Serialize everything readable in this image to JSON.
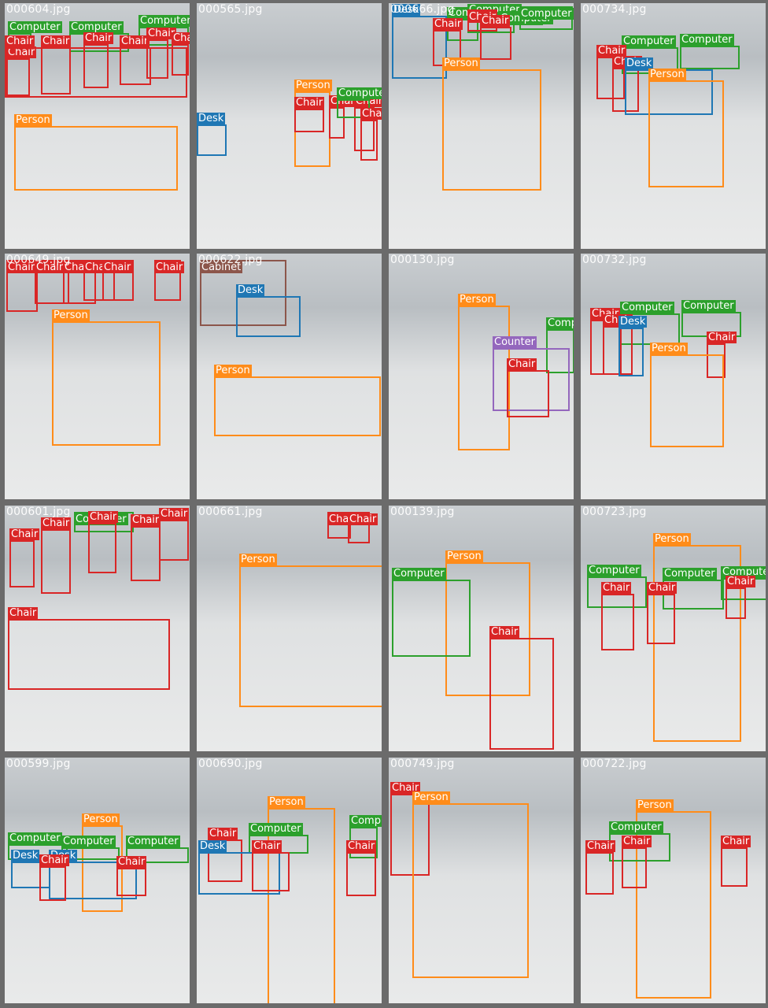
{
  "class_colors": {
    "Person": "#ff8c1a",
    "Chair": "#d92626",
    "Computer": "#2ca02c",
    "Desk": "#1f77b4",
    "Counter": "#9467bd",
    "Cabinet": "#8c564b"
  },
  "tiles": [
    {
      "filename": "000604.jpg",
      "boxes": [
        {
          "label": "Computer"
        },
        {
          "label": "Computer"
        },
        {
          "label": "Computer"
        },
        {
          "label": "Chair"
        },
        {
          "label": "Chair"
        },
        {
          "label": "Chair"
        },
        {
          "label": "Chair"
        },
        {
          "label": "Chair"
        },
        {
          "label": "Chair"
        },
        {
          "label": "Chair"
        },
        {
          "label": "Person"
        }
      ]
    },
    {
      "filename": "000565.jpg",
      "boxes": [
        {
          "label": "Desk"
        },
        {
          "label": "Person"
        },
        {
          "label": "Chair"
        },
        {
          "label": "Chair"
        },
        {
          "label": "Chair"
        },
        {
          "label": "Computer"
        },
        {
          "label": "Chair"
        }
      ]
    },
    {
      "filename": "000666.jpg",
      "boxes": [
        {
          "label": "Desk"
        },
        {
          "label": "Computer"
        },
        {
          "label": "Computer"
        },
        {
          "label": "Computer"
        },
        {
          "label": "Computer"
        },
        {
          "label": "Chair"
        },
        {
          "label": "Chair"
        },
        {
          "label": "Chair"
        },
        {
          "label": "Person"
        }
      ]
    },
    {
      "filename": "000734.jpg",
      "boxes": [
        {
          "label": "Computer"
        },
        {
          "label": "Computer"
        },
        {
          "label": "Chair"
        },
        {
          "label": "Chair"
        },
        {
          "label": "Desk"
        },
        {
          "label": "Person"
        }
      ]
    },
    {
      "filename": "000649.jpg",
      "boxes": [
        {
          "label": "Chair"
        },
        {
          "label": "Chair"
        },
        {
          "label": "Chair"
        },
        {
          "label": "Chair"
        },
        {
          "label": "Chair"
        },
        {
          "label": "Chair"
        },
        {
          "label": "Person"
        }
      ]
    },
    {
      "filename": "000622.jpg",
      "boxes": [
        {
          "label": "Cabinet"
        },
        {
          "label": "Desk"
        },
        {
          "label": "Person"
        }
      ]
    },
    {
      "filename": "000130.jpg",
      "boxes": [
        {
          "label": "Person"
        },
        {
          "label": "Computer"
        },
        {
          "label": "Counter"
        },
        {
          "label": "Chair"
        }
      ]
    },
    {
      "filename": "000732.jpg",
      "boxes": [
        {
          "label": "Computer"
        },
        {
          "label": "Computer"
        },
        {
          "label": "Chair"
        },
        {
          "label": "Chair"
        },
        {
          "label": "Desk"
        },
        {
          "label": "Chair"
        },
        {
          "label": "Person"
        }
      ]
    },
    {
      "filename": "000601.jpg",
      "boxes": [
        {
          "label": "Computer"
        },
        {
          "label": "Chair"
        },
        {
          "label": "Chair"
        },
        {
          "label": "Chair"
        },
        {
          "label": "Chair"
        },
        {
          "label": "Chair"
        },
        {
          "label": "Chair"
        },
        {
          "label": "Person"
        }
      ]
    },
    {
      "filename": "000661.jpg",
      "boxes": [
        {
          "label": "Chair"
        },
        {
          "label": "Chair"
        },
        {
          "label": "Person"
        }
      ]
    },
    {
      "filename": "000139.jpg",
      "boxes": [
        {
          "label": "Person"
        },
        {
          "label": "Computer"
        },
        {
          "label": "Chair"
        }
      ]
    },
    {
      "filename": "000723.jpg",
      "boxes": [
        {
          "label": "Person"
        },
        {
          "label": "Computer"
        },
        {
          "label": "Computer"
        },
        {
          "label": "Computer"
        },
        {
          "label": "Chair"
        },
        {
          "label": "Chair"
        },
        {
          "label": "Chair"
        }
      ]
    },
    {
      "filename": "000599.jpg",
      "boxes": [
        {
          "label": "Person"
        },
        {
          "label": "Computer"
        },
        {
          "label": "Computer"
        },
        {
          "label": "Computer"
        },
        {
          "label": "Desk"
        },
        {
          "label": "Desk"
        },
        {
          "label": "Chair"
        },
        {
          "label": "Chair"
        }
      ]
    },
    {
      "filename": "000690.jpg",
      "boxes": [
        {
          "label": "Person"
        },
        {
          "label": "Computer"
        },
        {
          "label": "Computer"
        },
        {
          "label": "Chair"
        },
        {
          "label": "Desk"
        },
        {
          "label": "Chair"
        },
        {
          "label": "Chair"
        }
      ]
    },
    {
      "filename": "000749.jpg",
      "boxes": [
        {
          "label": "Chair"
        },
        {
          "label": "Person"
        }
      ]
    },
    {
      "filename": "000722.jpg",
      "boxes": [
        {
          "label": "Person"
        },
        {
          "label": "Computer"
        },
        {
          "label": "Chair"
        },
        {
          "label": "Chair"
        },
        {
          "label": "Chair"
        }
      ]
    }
  ]
}
